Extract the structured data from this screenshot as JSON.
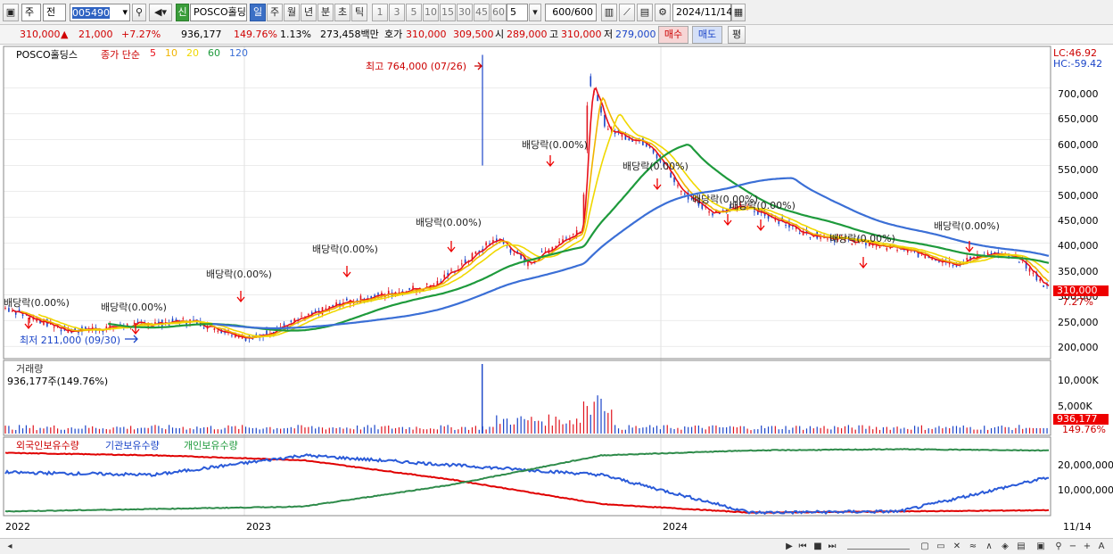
{
  "toolbar": {
    "type_sel": "주",
    "prev_sel": "전",
    "code": "005490",
    "sin_badge": "신",
    "name": "POSCO홀딩스",
    "periods": [
      "일",
      "주",
      "월",
      "년",
      "분",
      "초",
      "틱"
    ],
    "active_period": "일",
    "intervals": [
      "1",
      "3",
      "5",
      "10",
      "15",
      "30",
      "45",
      "60"
    ],
    "n_value": "5",
    "count": "600",
    "count_total": "/600",
    "date": "2024/11/14"
  },
  "quote": {
    "price": "310,000",
    "change": "21,000",
    "change_pct": "+7.27%",
    "volume": "936,177",
    "vol_ratio": "149.76%",
    "turnover": "1.13%",
    "amount": "273,458백만",
    "hoga_label": "호가",
    "ask": "310,000",
    "bid": "309,500",
    "open_label": "시",
    "open": "289,000",
    "high_label": "고",
    "high": "310,000",
    "low_label": "저",
    "low": "279,000",
    "buy_btn": "매수",
    "sell_btn": "매도",
    "eval_btn": "평"
  },
  "legend": {
    "stock": "POSCO홀딩스",
    "ma_label": "종가 단순",
    "ma": [
      {
        "period": "5",
        "color": "#e8101a"
      },
      {
        "period": "10",
        "color": "#f0b400"
      },
      {
        "period": "20",
        "color": "#f0d800"
      },
      {
        "period": "60",
        "color": "#1e9a3c"
      },
      {
        "period": "120",
        "color": "#3b6fd6"
      }
    ]
  },
  "price_panel": {
    "lc": "LC:46.92",
    "hc": "HC:-59.42",
    "high_note": "최고 764,000 (07/26)",
    "low_note": "최저 211,000 (09/30)",
    "last_price": "310,000",
    "last_pct": "7.27%",
    "dividends": [
      "배당락(0.00%)",
      "배당락(0.00%)",
      "배당락(0.00%)",
      "배당락(0.00%)",
      "배당락(0.00%)",
      "배당락(0.00%)",
      "배당락(0.00%)",
      "배당락(0.00%)",
      "배당락(0.00%)",
      "배당락(0.00%)",
      "배당락(0.00%)"
    ]
  },
  "volume_panel": {
    "title": "거래량",
    "value": "936,177주(149.76%)",
    "last": "936,177",
    "last_pct": "149.76%"
  },
  "holdings_panel": {
    "foreign": "외국인보유수량",
    "institution": "기관보유수량",
    "individual": "개인보유수량"
  },
  "x_axis": {
    "labels": [
      "2022",
      "2023",
      "2024"
    ],
    "end_label": "11/14"
  },
  "chart_data": [
    {
      "type": "line",
      "title": "POSCO홀딩스",
      "x": [
        "2022-01",
        "2022-04",
        "2022-07",
        "2022-09",
        "2022-12",
        "2023-03",
        "2023-06",
        "2023-07",
        "2023-09",
        "2023-12",
        "2024-03",
        "2024-06",
        "2024-09",
        "2024-11"
      ],
      "y_ticks": [
        "200,000",
        "250,000",
        "300,000",
        "350,000",
        "400,000",
        "450,000",
        "500,000",
        "550,000",
        "600,000",
        "650,000",
        "700,000"
      ],
      "ylim": [
        180000,
        770000
      ],
      "series": [
        {
          "name": "종가",
          "values": [
            275000,
            230000,
            250000,
            220000,
            285000,
            320000,
            400000,
            680000,
            560000,
            470000,
            440000,
            390000,
            370000,
            310000
          ]
        }
      ],
      "annotations": [
        "최고 764,000 (07/26)",
        "최저 211,000 (09/30)"
      ]
    },
    {
      "type": "bar",
      "title": "거래량",
      "y_ticks": [
        "5,000K",
        "10,000K"
      ],
      "ylim": [
        0,
        12000000
      ],
      "peak": 12000000
    },
    {
      "type": "line",
      "y_ticks": [
        "10,000,000",
        "20,000,000"
      ],
      "series": [
        {
          "name": "외국인보유수량",
          "values": [
            25000000,
            24000000,
            22000000,
            14000000,
            4000000,
            500000,
            1000000,
            1500000
          ]
        },
        {
          "name": "기관보유수량",
          "values": [
            17000000,
            16000000,
            24000000,
            20000000,
            16000000,
            500000,
            1000000,
            15000000
          ]
        },
        {
          "name": "개인보유수량",
          "values": [
            1000000,
            2000000,
            3000000,
            12000000,
            24000000,
            26000000,
            26500000,
            26000000
          ]
        }
      ]
    }
  ]
}
